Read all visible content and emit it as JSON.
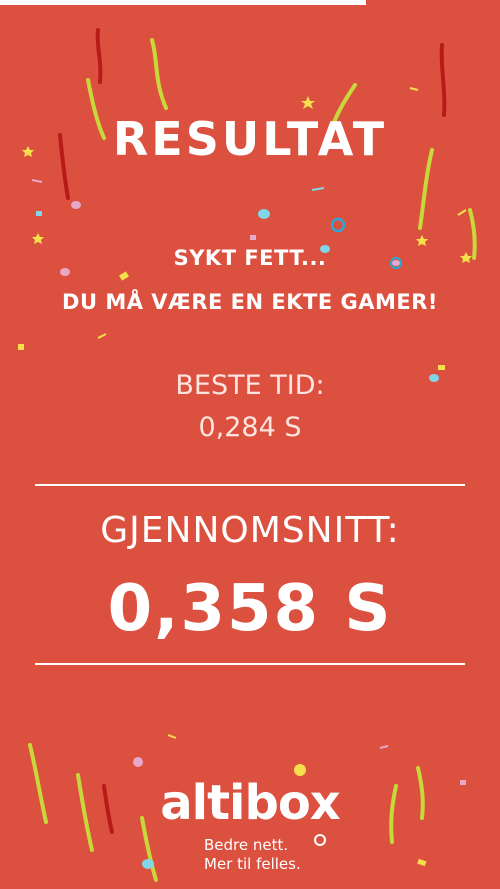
{
  "result": {
    "title": "RESULTAT",
    "message_line1": "SYKT FETT...",
    "message_line2": "DU MÅ VÆRE EN EKTE GAMER!",
    "best_label": "BESTE TID:",
    "best_value": "0,284 S",
    "average_label": "GJENNOMSNITT:",
    "average_value": "0,358 S"
  },
  "brand": {
    "name": "altibox",
    "tagline_line1": "Bedre nett.",
    "tagline_line2": "Mer til felles."
  },
  "colors": {
    "background": "#dc5040",
    "text": "#ffffff",
    "confetti": [
      "#f4e04a",
      "#c7d83a",
      "#b81a1a",
      "#7fd6e8",
      "#2aa8d8",
      "#e6a9c9",
      "#ffffff"
    ]
  }
}
